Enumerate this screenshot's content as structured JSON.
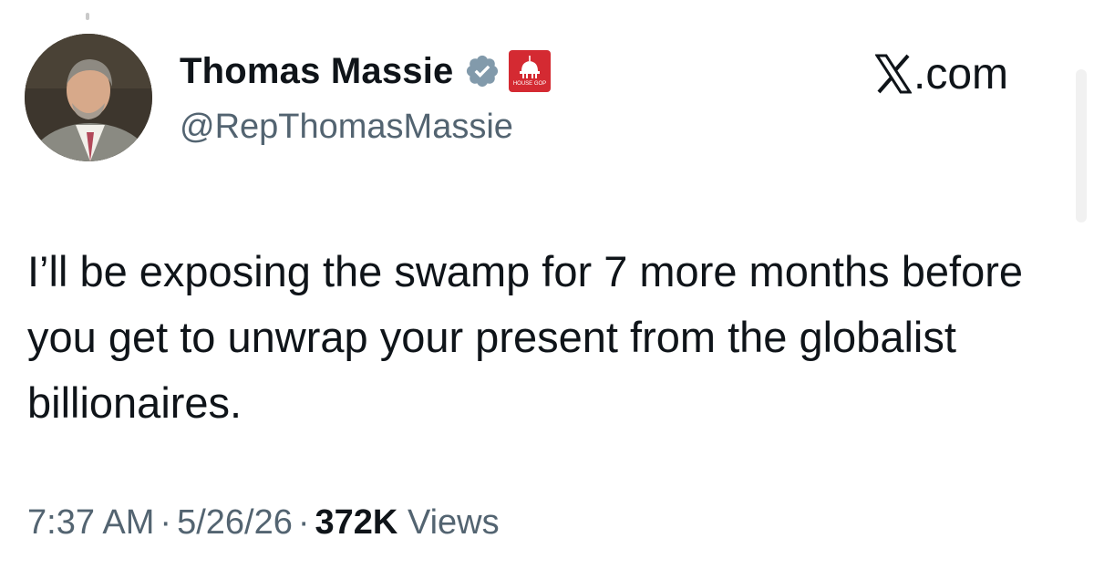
{
  "author": {
    "display_name": "Thomas Massie",
    "handle": "@RepThomasMassie",
    "avatar_icon": "profile-photo",
    "verified_icon": "verified-badge-icon",
    "verified_color": "#829aab",
    "affiliation_icon": "capitol-dome-icon",
    "affiliation_text": "HOUSE GOP",
    "affiliation_color": "#d42a32"
  },
  "brand": {
    "label": ".com",
    "icon": "x-logo-icon"
  },
  "tweet": {
    "text": "I’ll be exposing the swamp for 7 more months before you get to unwrap your present from the globalist billionaires."
  },
  "meta": {
    "time": "7:37 AM",
    "date": "5/26/26",
    "separator": "·",
    "views_count": "372K",
    "views_label": "Views"
  },
  "colors": {
    "text": "#0f1419",
    "secondary": "#536471"
  }
}
